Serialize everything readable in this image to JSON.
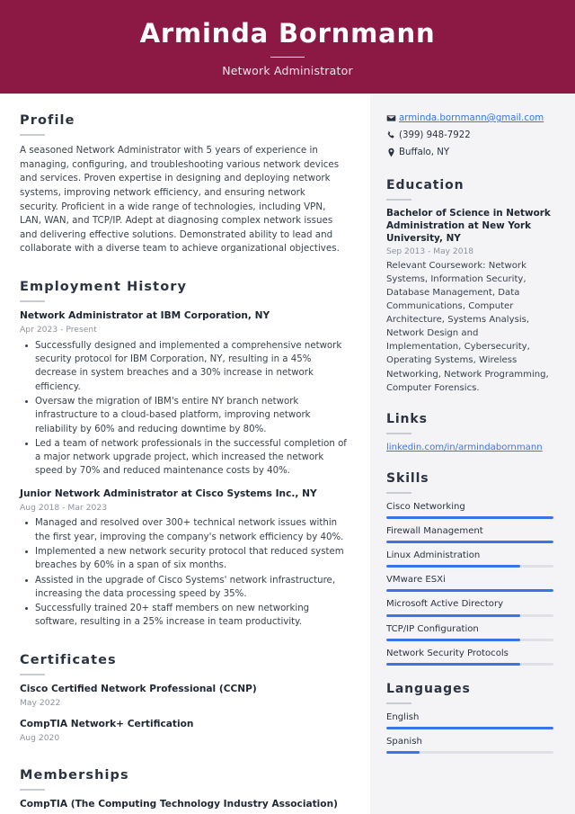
{
  "header": {
    "name": "Arminda Bornmann",
    "job_title": "Network Administrator",
    "background_color": "#8b1944"
  },
  "accent_colors": {
    "banner": "#8b1944",
    "bar_fill": "#3b74e8",
    "bar_track": "#dfe1e6",
    "link": "#3b74e8",
    "sidebar_background": "#f4f4f7"
  },
  "main": {
    "profile": {
      "heading": "Profile",
      "text": "A seasoned Network Administrator with 5 years of experience in managing, configuring, and troubleshooting various network devices and services. Proven expertise in designing and deploying network systems, improving network efficiency, and ensuring network security. Proficient in a wide range of technologies, including VPN, LAN, WAN, and TCP/IP. Adept at diagnosing complex network issues and delivering effective solutions. Demonstrated ability to lead and collaborate with a diverse team to achieve organizational objectives."
    },
    "employment": {
      "heading": "Employment History",
      "entries": [
        {
          "title": "Network Administrator at IBM Corporation, NY",
          "date": "Apr 2023 - Present",
          "bullets": [
            "Successfully designed and implemented a comprehensive network security protocol for IBM Corporation, NY, resulting in a 45% decrease in system breaches and a 30% increase in network efficiency.",
            "Oversaw the migration of IBM's entire NY branch network infrastructure to a cloud-based platform, improving network reliability by 60% and reducing downtime by 80%.",
            "Led a team of network professionals in the successful completion of a major network upgrade project, which increased the network speed by 70% and reduced maintenance costs by 40%."
          ]
        },
        {
          "title": "Junior Network Administrator at Cisco Systems Inc., NY",
          "date": "Aug 2018 - Mar 2023",
          "bullets": [
            "Managed and resolved over 300+ technical network issues within the first year, improving the company's network efficiency by 40%.",
            "Implemented a new network security protocol that reduced system breaches by 60% in a span of six months.",
            "Assisted in the upgrade of Cisco Systems' network infrastructure, increasing the data processing speed by 35%.",
            "Successfully trained 20+ staff members on new networking software, resulting in a 25% increase in team productivity."
          ]
        }
      ]
    },
    "certificates": {
      "heading": "Certificates",
      "entries": [
        {
          "title": "Cisco Certified Network Professional (CCNP)",
          "date": "May 2022"
        },
        {
          "title": "CompTIA Network+ Certification",
          "date": "Aug 2020"
        }
      ]
    },
    "memberships": {
      "heading": "Memberships",
      "entries": [
        {
          "title": "CompTIA (The Computing Technology Industry Association)"
        }
      ]
    }
  },
  "sidebar": {
    "contact": [
      {
        "icon": "email-icon",
        "value": "arminda.bornmann@gmail.com",
        "is_link": true
      },
      {
        "icon": "phone-icon",
        "value": "(399) 948-7922",
        "is_link": false
      },
      {
        "icon": "location-pin-icon",
        "value": "Buffalo, NY",
        "is_link": false
      }
    ],
    "education": {
      "heading": "Education",
      "entries": [
        {
          "title": "Bachelor of Science in Network Administration at New York University, NY",
          "date": "Sep 2013 - May 2018",
          "description": "Relevant Coursework: Network Systems, Information Security, Database Management, Data Communications, Computer Architecture, Systems Analysis, Network Design and Implementation, Cybersecurity, Operating Systems, Wireless Networking, Network Programming, Computer Forensics."
        }
      ]
    },
    "links": {
      "heading": "Links",
      "entries": [
        {
          "label": "linkedin.com/in/armindabornmann"
        }
      ]
    },
    "skills": {
      "heading": "Skills",
      "items": [
        {
          "label": "Cisco Networking",
          "level": 100
        },
        {
          "label": "Firewall Management",
          "level": 100
        },
        {
          "label": "Linux Administration",
          "level": 80
        },
        {
          "label": "VMware ESXi",
          "level": 100
        },
        {
          "label": "Microsoft Active Directory",
          "level": 80
        },
        {
          "label": "TCP/IP Configuration",
          "level": 80
        },
        {
          "label": "Network Security Protocols",
          "level": 80
        }
      ]
    },
    "languages": {
      "heading": "Languages",
      "items": [
        {
          "label": "English",
          "level": 100
        },
        {
          "label": "Spanish",
          "level": 20
        }
      ]
    }
  }
}
